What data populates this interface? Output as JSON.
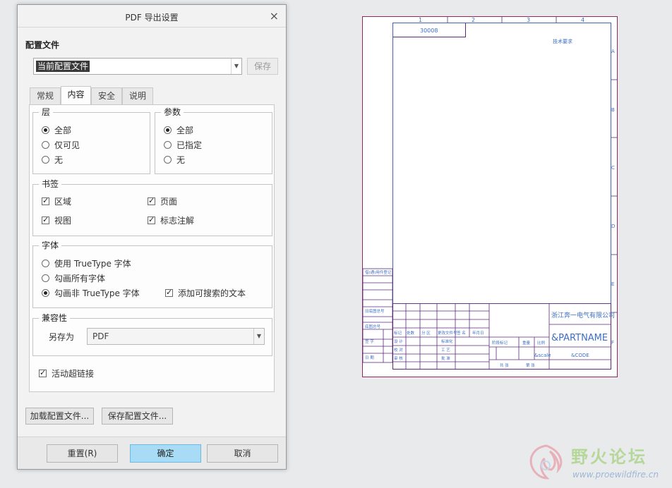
{
  "dialog": {
    "title": "PDF 导出设置",
    "close_glyph": "×",
    "config_section_label": "配置文件",
    "config_combo_value": "当前配置文件",
    "save_button": "保存",
    "tabs": [
      {
        "label": "常规",
        "active": false
      },
      {
        "label": "内容",
        "active": true
      },
      {
        "label": "安全",
        "active": false
      },
      {
        "label": "说明",
        "active": false
      }
    ],
    "layers": {
      "label": "层",
      "options": [
        "全部",
        "仅可见",
        "无"
      ],
      "selected": "全部"
    },
    "params": {
      "label": "参数",
      "options": [
        "全部",
        "已指定",
        "无"
      ],
      "selected": "全部"
    },
    "bookmarks": {
      "label": "书签",
      "items": [
        {
          "label": "区域",
          "checked": true
        },
        {
          "label": "页面",
          "checked": true
        },
        {
          "label": "视图",
          "checked": true
        },
        {
          "label": "标志注解",
          "checked": true
        }
      ]
    },
    "fonts": {
      "label": "字体",
      "options": [
        "使用 TrueType 字体",
        "勾画所有字体",
        "勾画非 TrueType 字体"
      ],
      "selected": "勾画非 TrueType 字体",
      "searchable_text": {
        "label": "添加可搜索的文本",
        "checked": true
      }
    },
    "compat": {
      "label": "兼容性",
      "save_as_label": "另存为",
      "save_as_value": "PDF"
    },
    "active_hyperlinks": {
      "label": "活动超链接",
      "checked": true
    },
    "load_config_button": "加载配置文件...",
    "save_config_button": "保存配置文件...",
    "reset_button": "重置(R)",
    "ok_button": "确定",
    "cancel_button": "取消"
  },
  "drawing": {
    "zone_numbers": [
      "1",
      "2",
      "3",
      "4"
    ],
    "zone_letters": [
      "A",
      "B",
      "C",
      "D",
      "E",
      "F"
    ],
    "drawing_number": "30008",
    "tech_requirements": "技术要求",
    "company": "浙江奔一电气有限公司",
    "part_name": "&PARTNAME",
    "scale_label": "&scale",
    "code_label": "&CODE",
    "title_block_labels": {
      "mark": "标记",
      "count": "处数",
      "zone": "分 区",
      "change_doc": "更改文件号",
      "signature": "签 名",
      "date": "年月日",
      "design": "设 计",
      "standardize": "标准化",
      "check": "校 对",
      "review": "审 核",
      "process": "工 艺",
      "approve": "批 准",
      "stage_mark": "阶段标记",
      "weight": "重量",
      "ratio": "比例",
      "sheets": "共 张",
      "sheet": "第 张"
    },
    "left_strip_labels": [
      "借(通)用件登记",
      "旧底图总号",
      "底图总号",
      "签 字",
      "日 期"
    ]
  },
  "watermark": {
    "title": "野火论坛",
    "url": "www.proewildfire.cn"
  }
}
